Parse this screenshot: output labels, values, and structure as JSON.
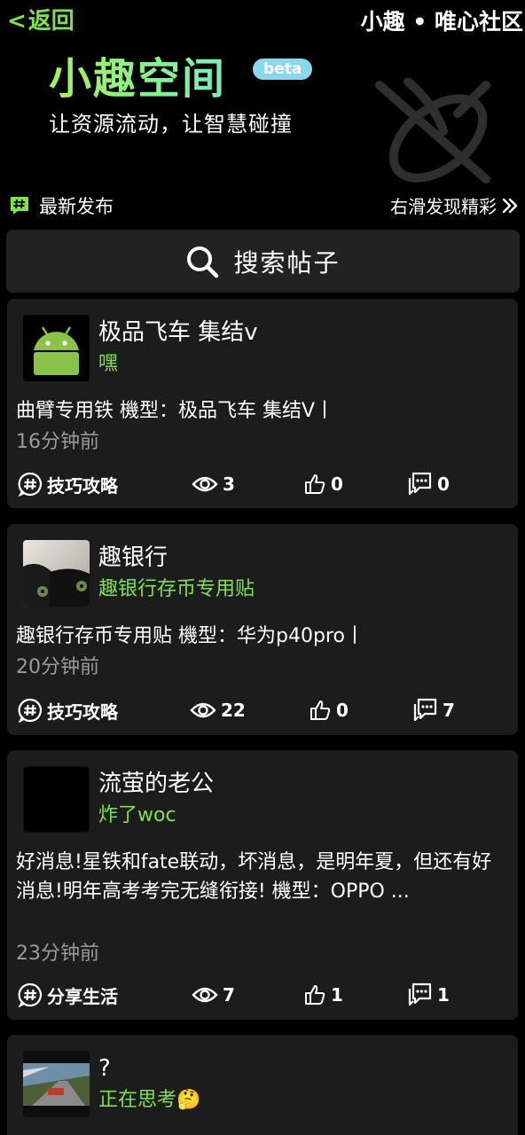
{
  "header": {
    "back_label": "返回",
    "community_title": "小趣 • 唯心社区"
  },
  "brand": {
    "title": "小趣空间",
    "badge": "beta",
    "slogan": "让资源流动，让智慧碰撞"
  },
  "section": {
    "latest_label": "最新发布",
    "swipe_hint": "右滑发现精彩"
  },
  "search": {
    "label": "搜索帖子"
  },
  "colors": {
    "accent_green": "#7ee24a",
    "card_bg": "#1c1c1c",
    "badge_blue": "#8ad7f0"
  },
  "posts": [
    {
      "avatar": "android-robot-icon",
      "title": "极品飞车 集结v",
      "subtitle": "嘿",
      "body": "曲臂专用铁 機型：极品飞车 集结V丨",
      "time": "16分钟前",
      "category": "技巧攻略",
      "views": "3",
      "likes": "0",
      "comments": "0"
    },
    {
      "avatar": "black-cat-photo",
      "title": "趣银行",
      "subtitle": "趣银行存币专用贴",
      "body": "趣银行存币专用贴 機型：华为p40pro丨",
      "time": "20分钟前",
      "category": "技巧攻略",
      "views": "22",
      "likes": "0",
      "comments": "7"
    },
    {
      "avatar": "black-square",
      "title": "流萤的老公",
      "subtitle": "炸了woc",
      "body": "好消息!星铁和fate联动，坏消息，是明年夏，但还有好消息!明年高考考完无缝衔接! 機型：OPPO ...",
      "time": "23分钟前",
      "category": "分享生活",
      "views": "7",
      "likes": "1",
      "comments": "1"
    },
    {
      "avatar": "racing-game-screenshot",
      "title": "?",
      "subtitle": "正在思考🤔"
    }
  ]
}
